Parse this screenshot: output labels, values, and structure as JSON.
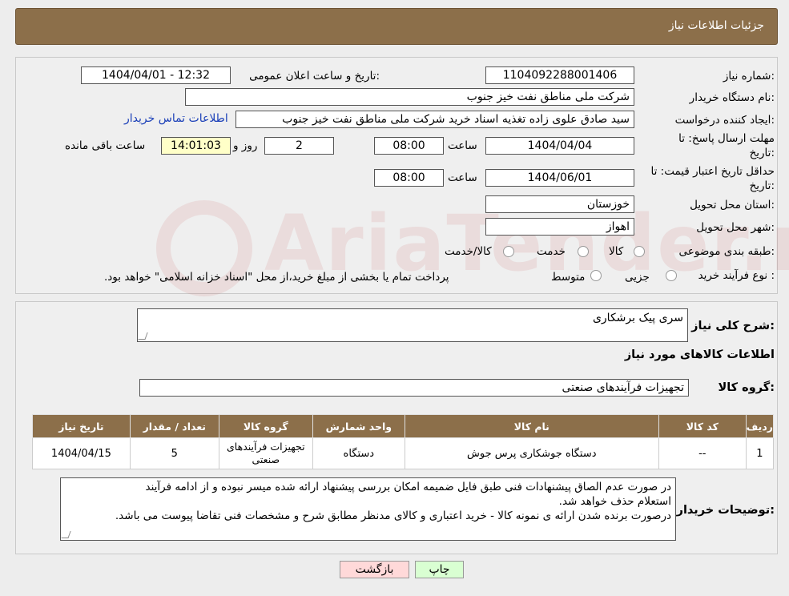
{
  "header": {
    "title": "جزئیات اطلاعات نیاز"
  },
  "info": {
    "need_number_label": "شماره نیاز:",
    "need_number": "1104092288001406",
    "announce_label": "تاریخ و ساعت اعلان عمومی:",
    "announce_value": "1404/04/01 - 12:32",
    "buyer_org_label": "نام دستگاه خریدار:",
    "buyer_org": "شرکت ملی مناطق نفت خیز جنوب",
    "creator_label": "ایجاد کننده درخواست:",
    "creator": "سید صادق علوی زاده  تغذیه اسناد خرید  شرکت ملی مناطق نفت خیز جنوب",
    "contact_link": "اطلاعات تماس خریدار",
    "deadline_label_1": "مهلت ارسال پاسخ: تا",
    "deadline_label_2": "تاریخ:",
    "deadline_date": "1404/04/04",
    "time_label": "ساعت",
    "deadline_time": "08:00",
    "days_value": "2",
    "days_label": "روز و",
    "remaining_time": "14:01:03",
    "remaining_label": "ساعت باقی مانده",
    "validity_label_1": "حداقل تاریخ اعتبار قیمت: تا",
    "validity_label_2": "تاریخ:",
    "validity_date": "1404/06/01",
    "validity_time_label": "ساعت",
    "validity_time": "08:00",
    "province_label": "استان محل تحویل:",
    "province": "خوزستان",
    "city_label": "شهر محل تحویل:",
    "city": "اهواز",
    "category_label": "طبقه بندی موضوعی:",
    "category_options": [
      "کالا",
      "خدمت",
      "کالا/خدمت"
    ],
    "process_label": "نوع فرآیند خرید :",
    "process_options": [
      "جزیی",
      "متوسط"
    ],
    "process_note": "پرداخت تمام یا بخشی از مبلغ خرید،از محل \"اسناد خزانه اسلامی\" خواهد بود."
  },
  "watermark": "AriaTender.neT",
  "summary": {
    "label": "شرح کلی نیاز:",
    "value": "سری پیک برشکاری",
    "goods_title": "اطلاعات کالاهای مورد نیاز",
    "group_label": "گروه کالا:",
    "group_value": "تجهیزات فرآیندهای صنعتی"
  },
  "table": {
    "headers": [
      "ردیف",
      "کد کالا",
      "نام کالا",
      "واحد شمارش",
      "گروه کالا",
      "تعداد / مقدار",
      "تاریخ نیاز"
    ],
    "rows": [
      [
        "1",
        "--",
        "دستگاه جوشکاری پرس جوش",
        "دستگاه",
        "تجهیزات فرآیندهای صنعتی",
        "5",
        "1404/04/15"
      ]
    ]
  },
  "notes": {
    "label": "توضیحات خریدار:",
    "line1": "در صورت عدم الصاق پیشنهادات فنی طبق فایل ضمیمه امکان بررسی پیشنهاد ارائه شده میسر نبوده و از ادامه فرآیند",
    "line2": "استعلام حذف خواهد شد.",
    "line3": "درصورت برنده شدن ارائه ی نمونه کالا - خرید اعتباری و کالای مدنظر مطابق شرح و مشخصات فنی تقاضا پیوست می باشد."
  },
  "buttons": {
    "print": "چاپ",
    "back": "بازگشت"
  },
  "colors": {
    "header_bg": "#8c6f4a",
    "back_button_bg": "#ffd9d9",
    "print_button_bg": "#d9ffd2",
    "link": "#1a3fb8"
  }
}
